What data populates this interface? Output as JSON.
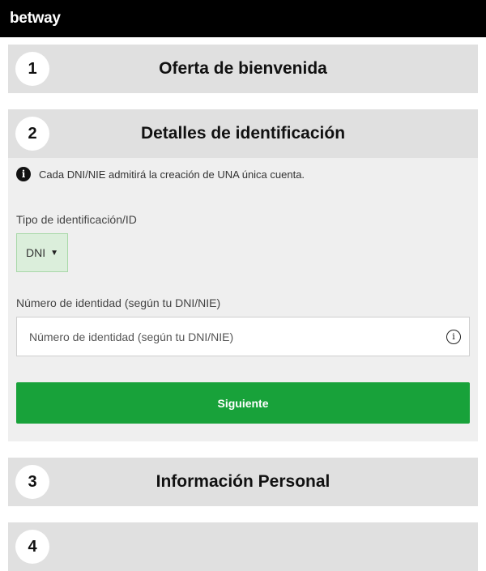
{
  "header": {
    "logo": "betway"
  },
  "steps": [
    {
      "number": "1",
      "title": "Oferta de bienvenida"
    },
    {
      "number": "2",
      "title": "Detalles de identificación"
    },
    {
      "number": "3",
      "title": "Información Personal"
    },
    {
      "number": "4",
      "title": ""
    }
  ],
  "identification": {
    "notice": "Cada DNI/NIE admitirá la creación de UNA única cuenta.",
    "id_type_label": "Tipo de identificación/ID",
    "id_type_value": "DNI",
    "id_number_label": "Número de identidad (según tu DNI/NIE)",
    "id_number_placeholder": "Número de identidad (según tu DNI/NIE)",
    "next_button": "Siguiente"
  },
  "colors": {
    "accent": "#18a23a",
    "header_bg": "#000000"
  }
}
